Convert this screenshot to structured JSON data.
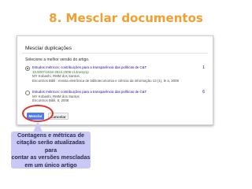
{
  "slide": {
    "title": "8. Mesclar documentos"
  },
  "dialog": {
    "title": "Mesclar duplicações",
    "prompt": "Selecione a melhor versão do artigo.",
    "options": [
      {
        "selected": true,
        "title": "Estudos métricos: contribuições para a transparência das políticas de C&T",
        "doi": "10.5007/1518-2924.2008 v13nesp1p",
        "authors": "MY Kobashi, RMM dos Santos",
        "source": "Encontros Bibli : revista eletrônica de biblioteconomia e ciência da informação 13 (1), le a, 2008",
        "count": "1"
      },
      {
        "selected": false,
        "title": "Estudos métricos: contribuições para a transparência das políticas de C&T",
        "authors": "MY Kobashi, RMM dos Santos",
        "source": "Encontros Bibli, 6, 2008",
        "count": "6"
      }
    ],
    "merge_label": "Mesclar",
    "cancel_label": "Cancelar"
  },
  "callout": {
    "lines": [
      "Contagens e métricas de",
      "citação serão atualizadas para",
      "contar as versões mescladas",
      "em um único artigo"
    ]
  },
  "colors": {
    "title": "#f0a030",
    "callout_bg": "#c9c9f7",
    "highlight_ring": "#e0312b",
    "primary_button": "#4d7cf0"
  }
}
